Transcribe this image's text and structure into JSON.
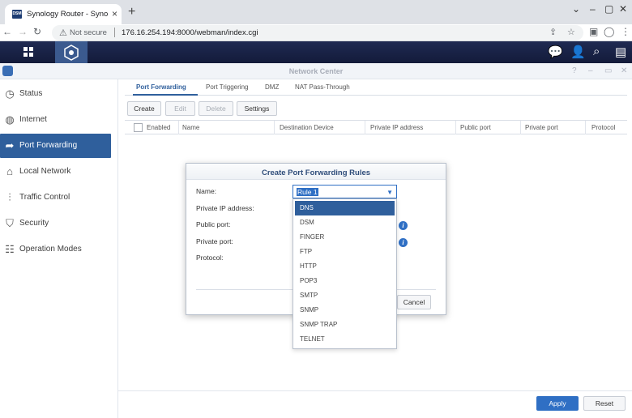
{
  "browser": {
    "tab_favicon_text": "DSM",
    "tab_title": "Synology Router - SynologyRouter",
    "tab_close": "×",
    "new_tab": "+",
    "not_secure": "Not secure",
    "url": "176.16.254.194:8000/webman/index.cgi"
  },
  "window": {
    "title": "Network Center"
  },
  "sidebar": {
    "items": [
      {
        "label": "Status",
        "icon": "status-icon"
      },
      {
        "label": "Internet",
        "icon": "globe-icon"
      },
      {
        "label": "Port Forwarding",
        "icon": "forward-arrow-icon"
      },
      {
        "label": "Local Network",
        "icon": "home-icon"
      },
      {
        "label": "Traffic Control",
        "icon": "sliders-icon"
      },
      {
        "label": "Security",
        "icon": "shield-icon"
      },
      {
        "label": "Operation Modes",
        "icon": "router-icon"
      }
    ],
    "active": "Port Forwarding"
  },
  "tabs": [
    "Port Forwarding",
    "Port Triggering",
    "DMZ",
    "NAT Pass-Through"
  ],
  "toolbar": {
    "create": "Create",
    "edit": "Edit",
    "delete": "Delete",
    "settings": "Settings"
  },
  "grid": {
    "columns": [
      "Enabled",
      "Name",
      "Destination Device",
      "Private IP address",
      "Public port",
      "Private port",
      "Protocol"
    ]
  },
  "dialog": {
    "title": "Create Port Forwarding Rules",
    "labels": {
      "name": "Name:",
      "private_ip": "Private IP address:",
      "public_port": "Public port:",
      "private_port": "Private port:",
      "protocol": "Protocol:"
    },
    "name_value": "Rule 1",
    "cancel": "Cancel"
  },
  "dropdown": {
    "options": [
      "DNS",
      "DSM",
      "FINGER",
      "FTP",
      "HTTP",
      "POP3",
      "SMTP",
      "SNMP",
      "SNMP TRAP",
      "TELNET"
    ],
    "selected": "DNS"
  },
  "footer": {
    "apply": "Apply",
    "reset": "Reset"
  },
  "colors": {
    "accent": "#2f5f9c",
    "primary_button": "#2f6fc4",
    "dsm_bar": "#1f2a52"
  }
}
